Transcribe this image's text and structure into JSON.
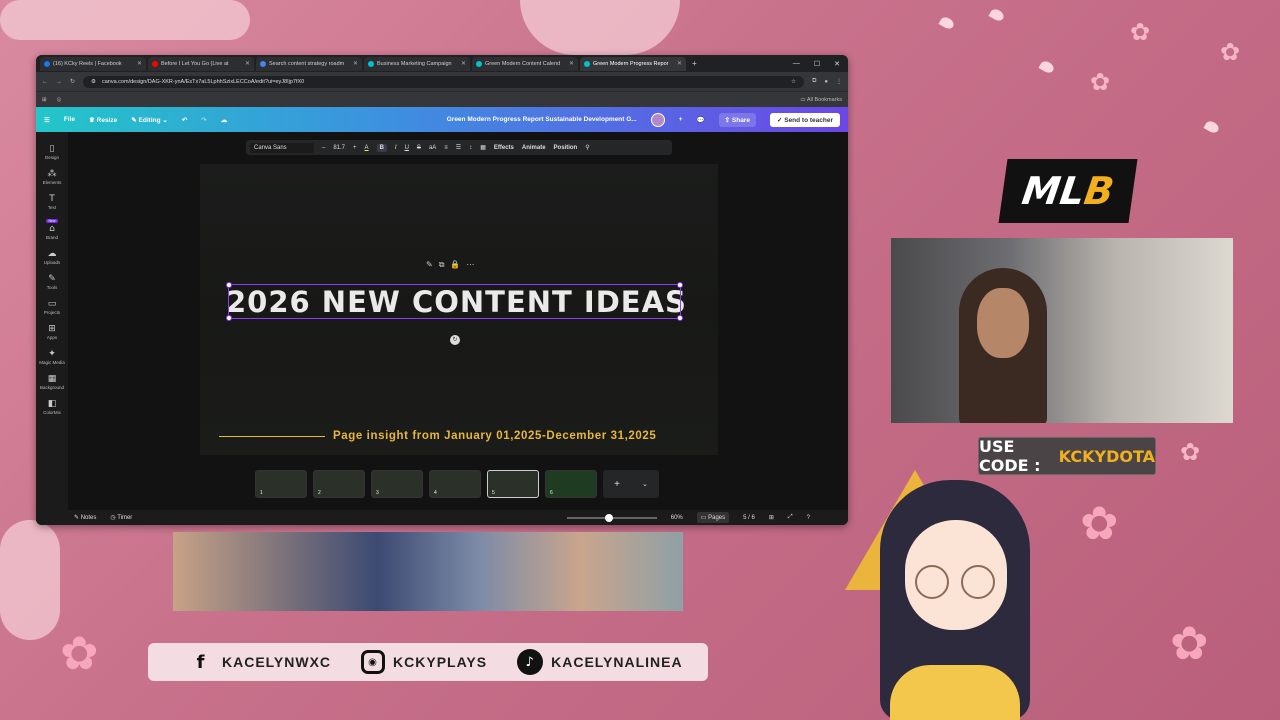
{
  "browser": {
    "tabs": [
      {
        "label": "(16) KCky Reels | Facebook",
        "color": "#1877f2"
      },
      {
        "label": "Before I Let You Go (Live at",
        "color": "#ff0000"
      },
      {
        "label": "Search content strategy roadm",
        "color": "#4285f4"
      },
      {
        "label": "Business Marketing Campaign",
        "color": "#00c4cc"
      },
      {
        "label": "Green Modern Content Calend",
        "color": "#00c4cc"
      },
      {
        "label": "Green Modern Progress Repor",
        "color": "#00c4cc"
      }
    ],
    "url": "canva.com/design/DAG-XKR-ynA/EsTx7aL5LphhSzixLECCoA/edit?ui=eyJ8Ijp7fX0",
    "bookmarks_label": "All Bookmarks"
  },
  "canva": {
    "menu": {
      "file": "File",
      "resize": "Resize",
      "editing": "Editing"
    },
    "doc_title": "Green Modern Progress Report Sustainable Development G...",
    "share": "Share",
    "send_to_teacher": "Send to teacher",
    "sidebar": [
      {
        "label": "Design",
        "icon": "▯"
      },
      {
        "label": "Elements",
        "icon": "⁂"
      },
      {
        "label": "Text",
        "icon": "T"
      },
      {
        "label": "Brand",
        "icon": "⌂"
      },
      {
        "label": "Uploads",
        "icon": "☁"
      },
      {
        "label": "Tools",
        "icon": "✎"
      },
      {
        "label": "Projects",
        "icon": "▭"
      },
      {
        "label": "Apps",
        "icon": "⊞"
      },
      {
        "label": "Magic Media",
        "icon": "✦"
      },
      {
        "label": "Background",
        "icon": "▦"
      },
      {
        "label": "ColorMix",
        "icon": "◧"
      }
    ],
    "brand_badge": "New",
    "toolbar": {
      "font": "Canva Sans",
      "size": "81.7",
      "effects": "Effects",
      "animate": "Animate",
      "position": "Position"
    },
    "canvas": {
      "title": "2026 NEW CONTENT IDEAS",
      "subtitle": "Page insight from January 01,2025-December 31,2025"
    },
    "pages": [
      "1",
      "2",
      "3",
      "4",
      "5",
      "6"
    ],
    "bottom": {
      "notes": "Notes",
      "timer": "Timer",
      "zoom": "60%",
      "pages_label": "Pages",
      "page_count": "5 / 6"
    }
  },
  "overlay": {
    "logo_main": "ML",
    "logo_accent": "B",
    "code_label": "USE CODE :",
    "code_value": "KCKYDOTA",
    "socials": [
      {
        "icon": "f",
        "handle": "KACELYNWXC"
      },
      {
        "icon": "◉",
        "handle": "KCKYPLAYS"
      },
      {
        "icon": "♪",
        "handle": "KACELYNALINEA"
      }
    ]
  }
}
